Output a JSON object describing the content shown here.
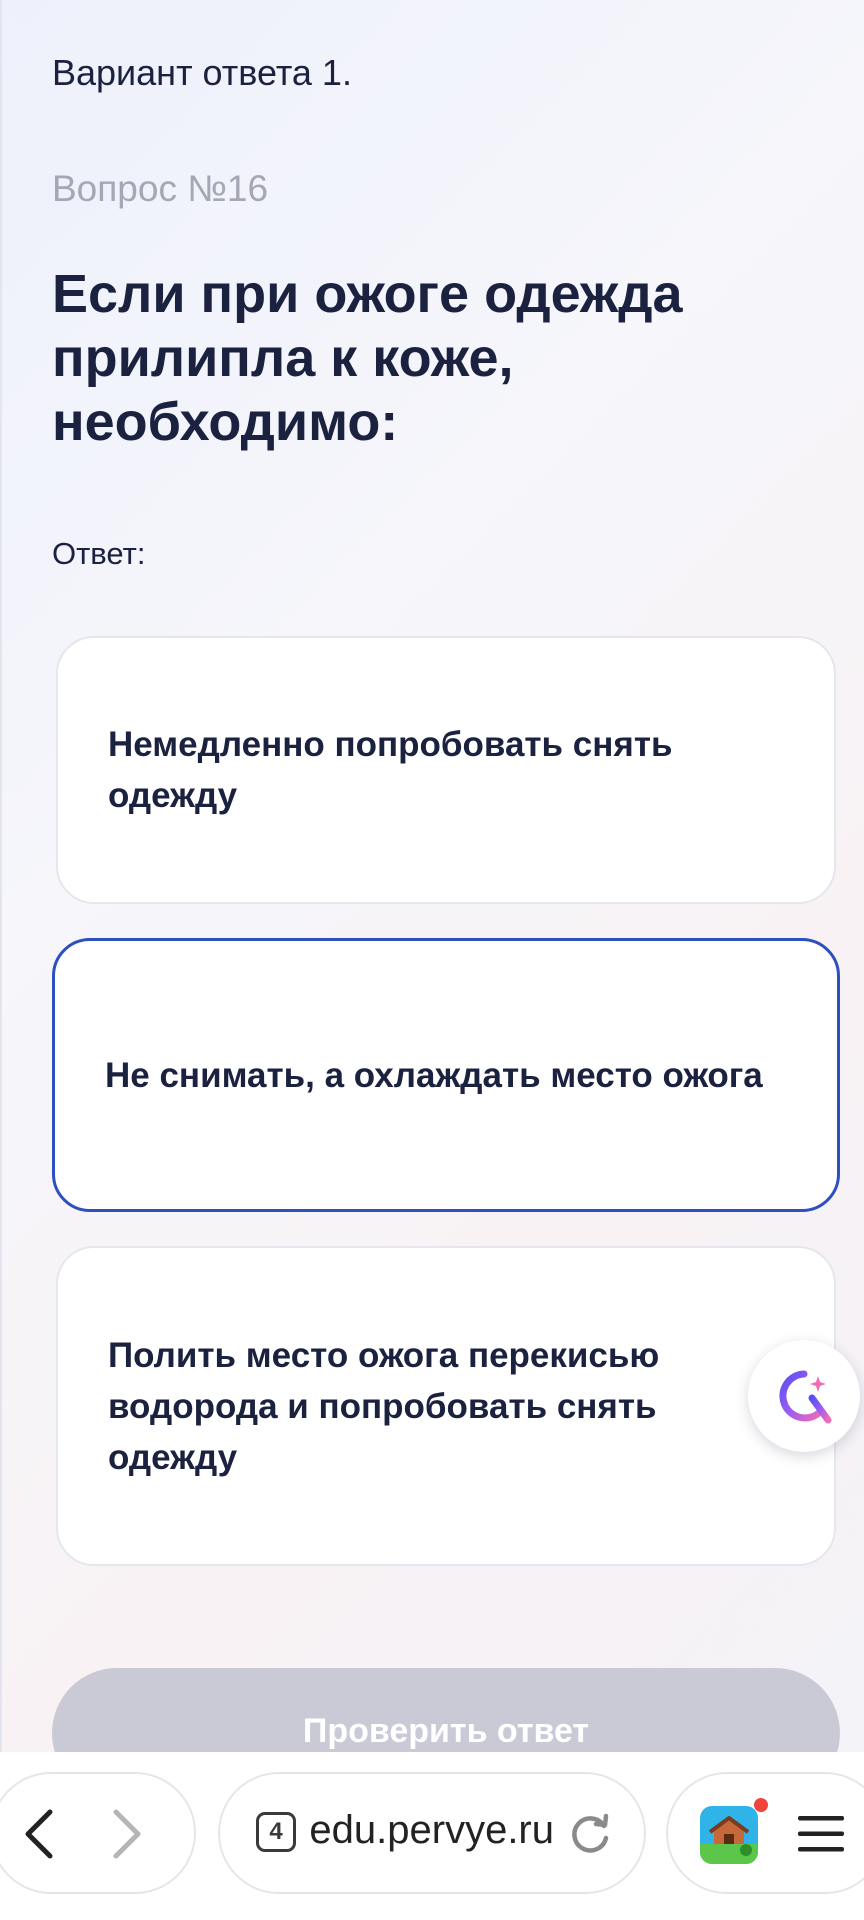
{
  "quiz": {
    "previous_answer": "Вариант ответа 1.",
    "question_number": "Вопрос №16",
    "question_text": "Если при ожоге одежда прилипла к коже, необходимо:",
    "answer_label": "Ответ:",
    "options": [
      {
        "label": "Немедленно попробовать снять одежду",
        "selected": false
      },
      {
        "label": "Не снимать, а охлаждать место ожога",
        "selected": true
      },
      {
        "label": "Полить место ожога перекисью водорода и попробовать снять одежду",
        "selected": false
      }
    ],
    "check_button_label": "Проверить ответ"
  },
  "browser": {
    "tab_count": "4",
    "url": "edu.pervye.ru"
  },
  "colors": {
    "accent": "#2d4fbf",
    "text": "#1b2240",
    "muted": "#a4a7b4",
    "button_disabled": "#c9cad6"
  },
  "icons": {
    "assistant": "assistant-icon",
    "back": "chevron-left-icon",
    "forward": "chevron-right-icon",
    "reload": "reload-icon",
    "game": "game-app-icon",
    "menu": "hamburger-menu-icon"
  }
}
